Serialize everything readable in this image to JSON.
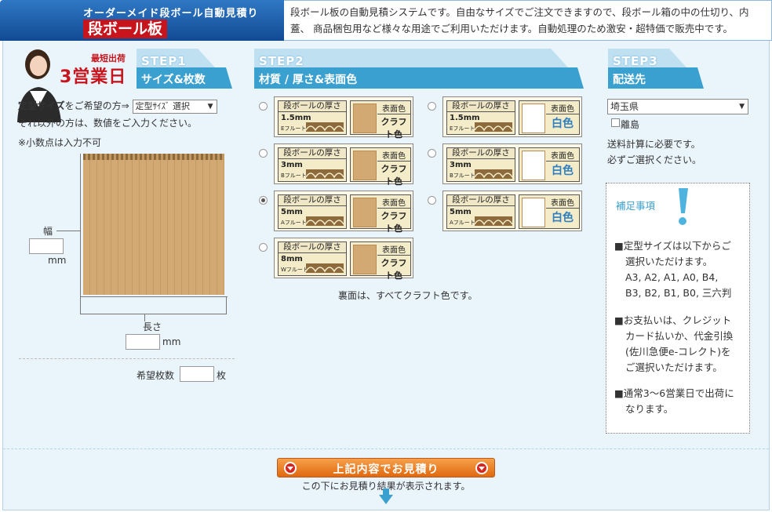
{
  "header": {
    "subtitle": "オーダーメイド段ボール自動見積り",
    "title": "段ボール板",
    "description": "段ボール板の自動見積システムです。自由なサイズでご注文できますので、段ボール箱の中の仕切り、内蓋、 商品梱包用など様々な用途でご利用いただけます。自動処理のため激安・超特価で販売中です。",
    "shortest_label": "最短出荷",
    "shortest_days": "3営業日"
  },
  "steps": [
    {
      "tag": "STEP1",
      "title": "サイズ&枚数"
    },
    {
      "tag": "STEP2",
      "title": "材質 / 厚さ&表面色"
    },
    {
      "tag": "STEP3",
      "title": "配送先"
    }
  ],
  "step1": {
    "std_label_bold": "定型サイズ",
    "std_label_rest": "をご希望の方⇒",
    "std_select": "定型ｻｲｽﾞ 選択",
    "other_text": "それ以外の方は、数値をご入力ください。",
    "decimal_note": "※小数点は入力不可",
    "width_label": "幅",
    "width_unit": "mm",
    "length_label": "長さ",
    "length_unit": "mm",
    "qty_label": "希望枚数",
    "qty_unit": "枚",
    "width_value": "",
    "length_value": "",
    "qty_value": ""
  },
  "step2": {
    "thickness_header": "段ボールの厚さ",
    "color_header": "表面色",
    "options": [
      {
        "mm": "1.5mm",
        "flute": "Eフルート",
        "color": "クラフト色",
        "kraft": true,
        "selected": false
      },
      {
        "mm": "1.5mm",
        "flute": "Eフルート",
        "color": "白色",
        "kraft": false,
        "selected": false
      },
      {
        "mm": "3mm",
        "flute": "Bフルート",
        "color": "クラフト色",
        "kraft": true,
        "selected": false
      },
      {
        "mm": "3mm",
        "flute": "Bフルート",
        "color": "白色",
        "kraft": false,
        "selected": false
      },
      {
        "mm": "5mm",
        "flute": "Aフルート",
        "color": "クラフト色",
        "kraft": true,
        "selected": true
      },
      {
        "mm": "5mm",
        "flute": "Aフルート",
        "color": "白色",
        "kraft": false,
        "selected": false
      },
      {
        "mm": "8mm",
        "flute": "Wフルート",
        "color": "クラフト色",
        "kraft": true,
        "selected": false
      }
    ],
    "back_note": "裏面は、すべてクラフト色です。"
  },
  "step3": {
    "prefecture": "埼玉県",
    "island_label": "離島",
    "shipping_note1": "送料計算に必要です。",
    "shipping_note2": "必ずご選択ください。"
  },
  "notes": {
    "title": "補足事項",
    "items": [
      [
        "■定型サイズは以下からご",
        "選択いただけます。",
        "A3, A2, A1, A0, B4,",
        "B3, B2, B1, B0, 三六判"
      ],
      [
        "■お支払いは、クレジット",
        "カード払いか、代金引換",
        "(佐川急便e-コレクト)を",
        "ご選択いただけます。"
      ],
      [
        "■通常3～6営業日で出荷に",
        "なります。"
      ]
    ]
  },
  "footer": {
    "button": "上記内容でお見積り",
    "hint": "この下にお見積り結果が表示されます。"
  },
  "colors": {
    "accent": "#3aa0cf",
    "header": "#1e5fa8",
    "title_red": "#c8141c",
    "button": "#e9791f",
    "kraft": "#d2a873"
  }
}
